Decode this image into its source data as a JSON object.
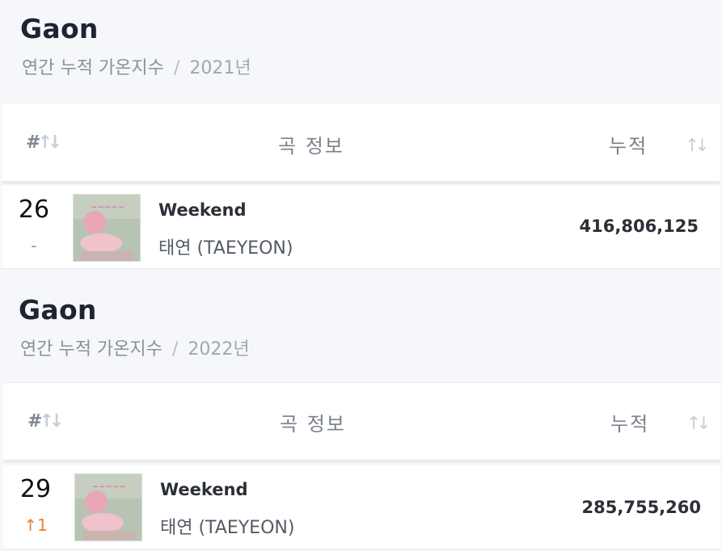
{
  "sections": [
    {
      "title": "Gaon",
      "subtitle": "연간 누적 가온지수",
      "separator": "/",
      "year": "2021년",
      "header": {
        "rank_label": "#",
        "sort_arrows": "↑↓",
        "song_col": "곡 정보",
        "cum_col": "누적",
        "cum_sort": "↑↓"
      },
      "row": {
        "rank": "26",
        "change": "-",
        "title": "Weekend",
        "artist": "태연 (TAEYEON)",
        "cumulative": "416,806,125",
        "album_icon": "album-cover"
      }
    },
    {
      "title": "Gaon",
      "subtitle": "연간 누적 가온지수",
      "separator": "/",
      "year": "2022년",
      "header": {
        "rank_label": "#",
        "sort_arrows": "↑↓",
        "song_col": "곡 정보",
        "cum_col": "누적",
        "cum_sort": "↑↓"
      },
      "row": {
        "rank": "29",
        "change": "↑1",
        "title": "Weekend",
        "artist": "태연 (TAEYEON)",
        "cumulative": "285,755,260",
        "album_icon": "album-cover"
      }
    }
  ],
  "colors": {
    "change_up": "#e7822c",
    "background": "#f6f7fa"
  }
}
